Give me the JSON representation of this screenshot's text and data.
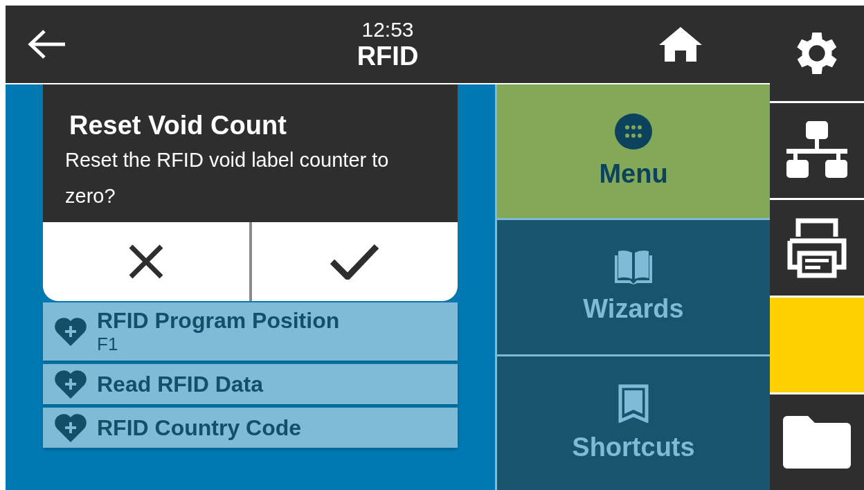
{
  "header": {
    "time": "12:53",
    "title": "RFID"
  },
  "side_buttons": [
    {
      "kind": "settings"
    },
    {
      "kind": "network"
    },
    {
      "kind": "printer"
    },
    {
      "kind": "alert"
    },
    {
      "kind": "files"
    }
  ],
  "dialog": {
    "title": "Reset Void Count",
    "message": "Reset the RFID void label counter to zero?",
    "buttons": [
      {
        "kind": "cancel"
      },
      {
        "kind": "confirm"
      }
    ]
  },
  "list_items": [
    {
      "label": "RFID Program Position",
      "value": "F1"
    },
    {
      "label": "Read RFID Data"
    },
    {
      "label": "RFID Country Code"
    }
  ],
  "nav": [
    {
      "kind": "menu",
      "label": "Menu",
      "selected": true
    },
    {
      "kind": "wizards",
      "label": "Wizards",
      "selected": false
    },
    {
      "kind": "shortcuts",
      "label": "Shortcuts",
      "selected": false
    }
  ]
}
